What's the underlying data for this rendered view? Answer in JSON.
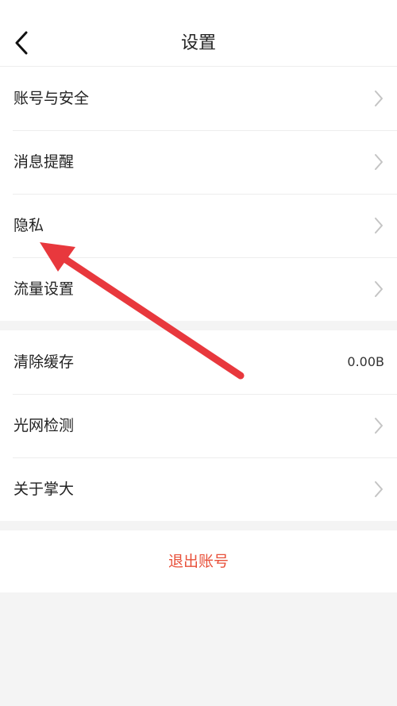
{
  "header": {
    "title": "设置"
  },
  "groups": [
    {
      "items": [
        {
          "label": "账号与安全",
          "trailing": "chevron-right-icon"
        },
        {
          "label": "消息提醒",
          "trailing": "chevron-right-icon"
        },
        {
          "label": "隐私",
          "trailing": "chevron-right-icon"
        },
        {
          "label": "流量设置",
          "trailing": "chevron-right-icon"
        }
      ]
    },
    {
      "items": [
        {
          "label": "清除缓存",
          "value": "0.00B"
        },
        {
          "label": "光网检测",
          "trailing": "chevron-right-icon"
        },
        {
          "label": "关于掌大",
          "trailing": "chevron-right-icon"
        }
      ]
    }
  ],
  "logout_label": "退出账号",
  "colors": {
    "background": "#f4f4f4",
    "surface": "#ffffff",
    "text": "#222222",
    "chevron": "#c4c4c4",
    "logout": "#e8503a",
    "annotation_arrow": "#e8383d"
  }
}
